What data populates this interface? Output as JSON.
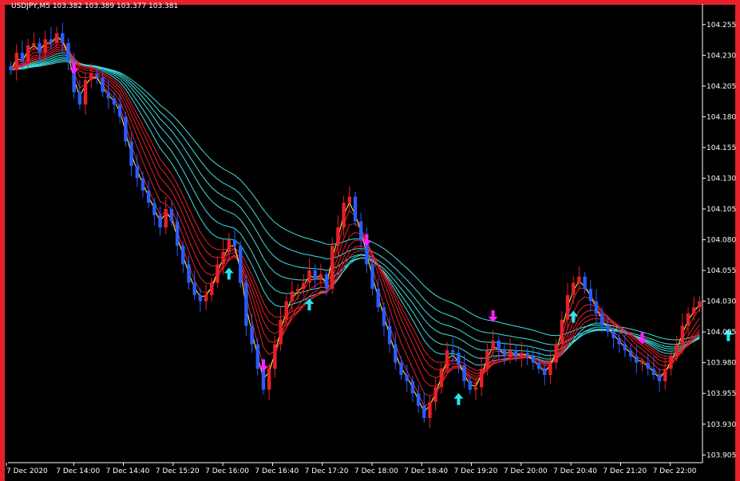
{
  "window": {
    "title": "USDJPY,M5  103.382 103.389 103.377 103.381",
    "frame_color": "#e8202a",
    "background": "#000000"
  },
  "chart_data": {
    "type": "candlestick",
    "symbol": "USDJPY",
    "timeframe": "M5",
    "y_ticks": [
      "104.255",
      "104.230",
      "104.205",
      "104.180",
      "104.155",
      "104.130",
      "104.105",
      "104.080",
      "104.055",
      "104.030",
      "104.005",
      "103.980",
      "103.955",
      "103.930",
      "103.905"
    ],
    "y_values": [
      104.255,
      104.23,
      104.205,
      104.18,
      104.155,
      104.13,
      104.105,
      104.08,
      104.055,
      104.03,
      104.005,
      103.98,
      103.955,
      103.93,
      103.905
    ],
    "ylim": [
      103.9,
      104.262
    ],
    "x_ticks": [
      "7 Dec 2020",
      "7 Dec 14:00",
      "7 Dec 14:40",
      "7 Dec 15:20",
      "7 Dec 16:00",
      "7 Dec 16:40",
      "7 Dec 17:20",
      "7 Dec 18:00",
      "7 Dec 18:40",
      "7 Dec 19:20",
      "7 Dec 20:00",
      "7 Dec 20:40",
      "7 Dec 21:20",
      "7 Dec 22:00"
    ],
    "colors": {
      "bull": "#e8202a",
      "bear": "#2a5cff",
      "fast_ma": "#e8202a",
      "slow_ma": "#40e0e0",
      "signal": "#ffff40",
      "down_arrow": "#ff20ff",
      "up_arrow": "#20e8f0"
    },
    "close": [
      104.218,
      104.232,
      104.225,
      104.238,
      104.24,
      104.232,
      104.243,
      104.24,
      104.248,
      104.24,
      104.225,
      104.2,
      104.19,
      104.21,
      104.215,
      104.212,
      104.2,
      104.195,
      104.19,
      104.18,
      104.16,
      104.14,
      104.13,
      104.12,
      104.11,
      104.1,
      104.09,
      104.105,
      104.095,
      104.075,
      104.06,
      104.045,
      104.035,
      104.03,
      104.035,
      104.045,
      104.06,
      104.07,
      104.08,
      104.075,
      104.045,
      104.01,
      103.995,
      103.975,
      103.958,
      103.975,
      103.995,
      104.015,
      104.03,
      104.038,
      104.04,
      104.045,
      104.055,
      104.048,
      104.052,
      104.04,
      104.075,
      104.09,
      104.11,
      104.115,
      104.095,
      104.08,
      104.06,
      104.04,
      104.025,
      104.01,
      103.995,
      103.98,
      103.97,
      103.965,
      103.955,
      103.945,
      103.935,
      103.948,
      103.96,
      103.975,
      103.99,
      103.988,
      103.978,
      103.965,
      103.958,
      103.96,
      103.975,
      103.99,
      103.998,
      103.99,
      103.985,
      103.99,
      103.985,
      103.988,
      103.985,
      103.98,
      103.975,
      103.97,
      103.98,
      103.995,
      104.015,
      104.035,
      104.045,
      104.05,
      104.04,
      104.03,
      104.02,
      104.01,
      104.005,
      104.0,
      103.995,
      103.99,
      103.985,
      103.98,
      103.98,
      103.975,
      103.97,
      103.965,
      103.975,
      103.985,
      103.995,
      104.01,
      104.02,
      104.025,
      104.03
    ],
    "down_arrows": [
      {
        "i": 11
      },
      {
        "i": 44
      },
      {
        "i": 62
      },
      {
        "i": 84
      },
      {
        "i": 110
      }
    ],
    "up_arrows": [
      {
        "i": 38
      },
      {
        "i": 52
      },
      {
        "i": 78
      },
      {
        "i": 98
      },
      {
        "i": 125
      }
    ]
  }
}
